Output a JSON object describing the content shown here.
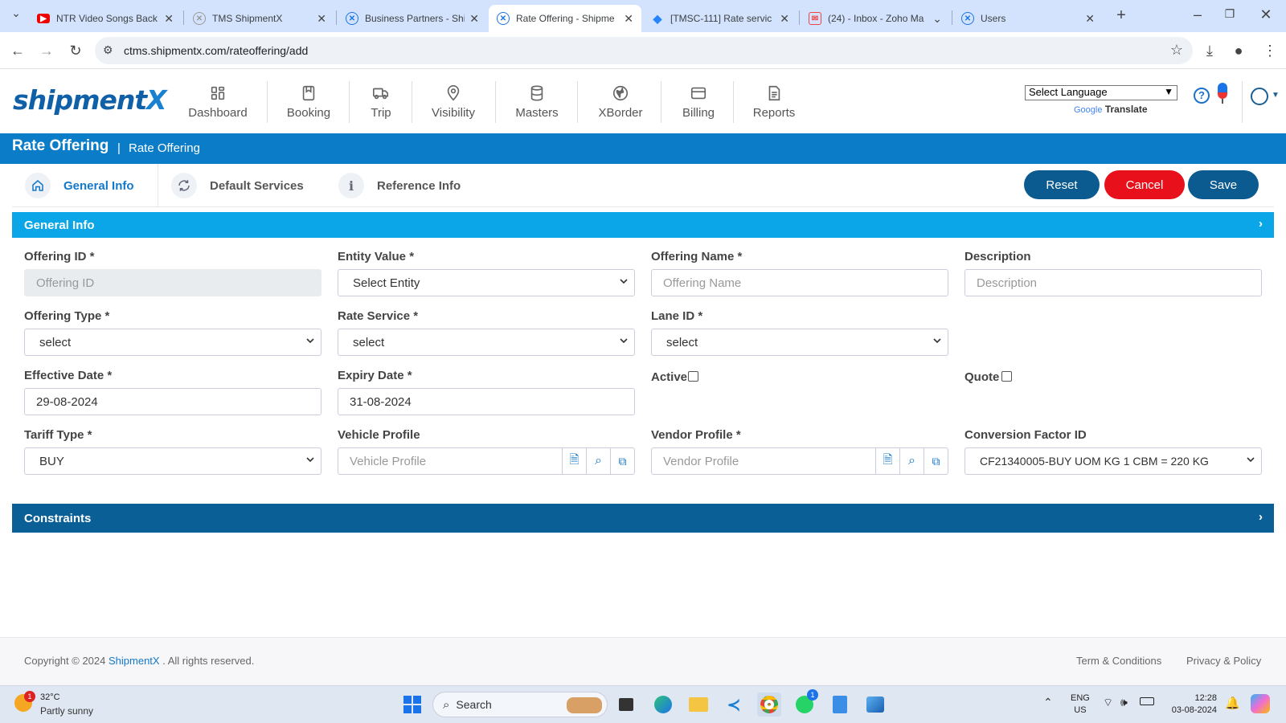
{
  "browser": {
    "tabs": [
      {
        "title": "NTR Video Songs Back",
        "icon": "youtube-icon"
      },
      {
        "title": "TMS ShipmentX",
        "icon": "shipmentx-icon"
      },
      {
        "title": "Business Partners - Shi",
        "icon": "shipmentx-icon"
      },
      {
        "title": "Rate Offering - Shipme",
        "icon": "shipmentx-icon",
        "active": true
      },
      {
        "title": "[TMSC-111] Rate servic",
        "icon": "jira-icon"
      },
      {
        "title": "(24) - Inbox - Zoho Ma",
        "icon": "zoho-icon"
      },
      {
        "title": "Users",
        "icon": "shipmentx-icon"
      }
    ],
    "url": "ctms.shipmentx.com/rateoffering/add"
  },
  "app": {
    "logo": {
      "main": "shipment",
      "accent": "X"
    },
    "nav": [
      "Dashboard",
      "Booking",
      "Trip",
      "Visibility",
      "Masters",
      "XBorder",
      "Billing",
      "Reports"
    ],
    "language_select": "Select Language",
    "google": "Google",
    "translate": "Translate"
  },
  "page": {
    "title": "Rate Offering",
    "breadcrumb_sep": "|",
    "breadcrumb": "Rate Offering",
    "tabs": [
      "General Info",
      "Default Services",
      "Reference Info"
    ],
    "buttons": {
      "reset": "Reset",
      "cancel": "Cancel",
      "save": "Save"
    },
    "section_general": "General Info",
    "section_constraints": "Constraints"
  },
  "form": {
    "offering_id": {
      "label": "Offering ID *",
      "placeholder": "Offering ID"
    },
    "entity_value": {
      "label": "Entity Value *",
      "value": "Select Entity"
    },
    "offering_name": {
      "label": "Offering Name *",
      "placeholder": "Offering Name"
    },
    "description": {
      "label": "Description",
      "placeholder": "Description"
    },
    "offering_type": {
      "label": "Offering Type *",
      "value": "select"
    },
    "rate_service": {
      "label": "Rate Service *",
      "value": "select"
    },
    "lane_id": {
      "label": "Lane ID *",
      "value": "select"
    },
    "effective_date": {
      "label": "Effective Date *",
      "value": "29-08-2024"
    },
    "expiry_date": {
      "label": "Expiry Date *",
      "value": "31-08-2024"
    },
    "active": {
      "label": "Active",
      "checked": false
    },
    "quote": {
      "label": "Quote",
      "checked": false
    },
    "tariff_type": {
      "label": "Tariff Type *",
      "value": "BUY"
    },
    "vehicle_profile": {
      "label": "Vehicle Profile",
      "placeholder": "Vehicle Profile"
    },
    "vendor_profile": {
      "label": "Vendor Profile *",
      "placeholder": "Vendor Profile"
    },
    "conversion_factor": {
      "label": "Conversion Factor ID",
      "value": "CF21340005-BUY UOM KG 1 CBM = 220 KG"
    }
  },
  "footer": {
    "copyright": "Copyright © 2024",
    "brand": "ShipmentX",
    "rights": ". All rights reserved.",
    "terms": "Term & Conditions",
    "privacy": "Privacy & Policy"
  },
  "taskbar": {
    "weather_temp": "32°C",
    "weather_desc": "Partly sunny",
    "weather_badge": "1",
    "search": "Search",
    "whatsapp_badge": "1",
    "lang1": "ENG",
    "lang2": "US",
    "time": "12:28",
    "date": "03-08-2024"
  },
  "colors": {
    "brand_blue": "#0b7dc8",
    "section_light": "#0aa6e8",
    "section_dark": "#0a5f96",
    "cancel_red": "#e8101a",
    "button_dark": "#0b5a90"
  }
}
